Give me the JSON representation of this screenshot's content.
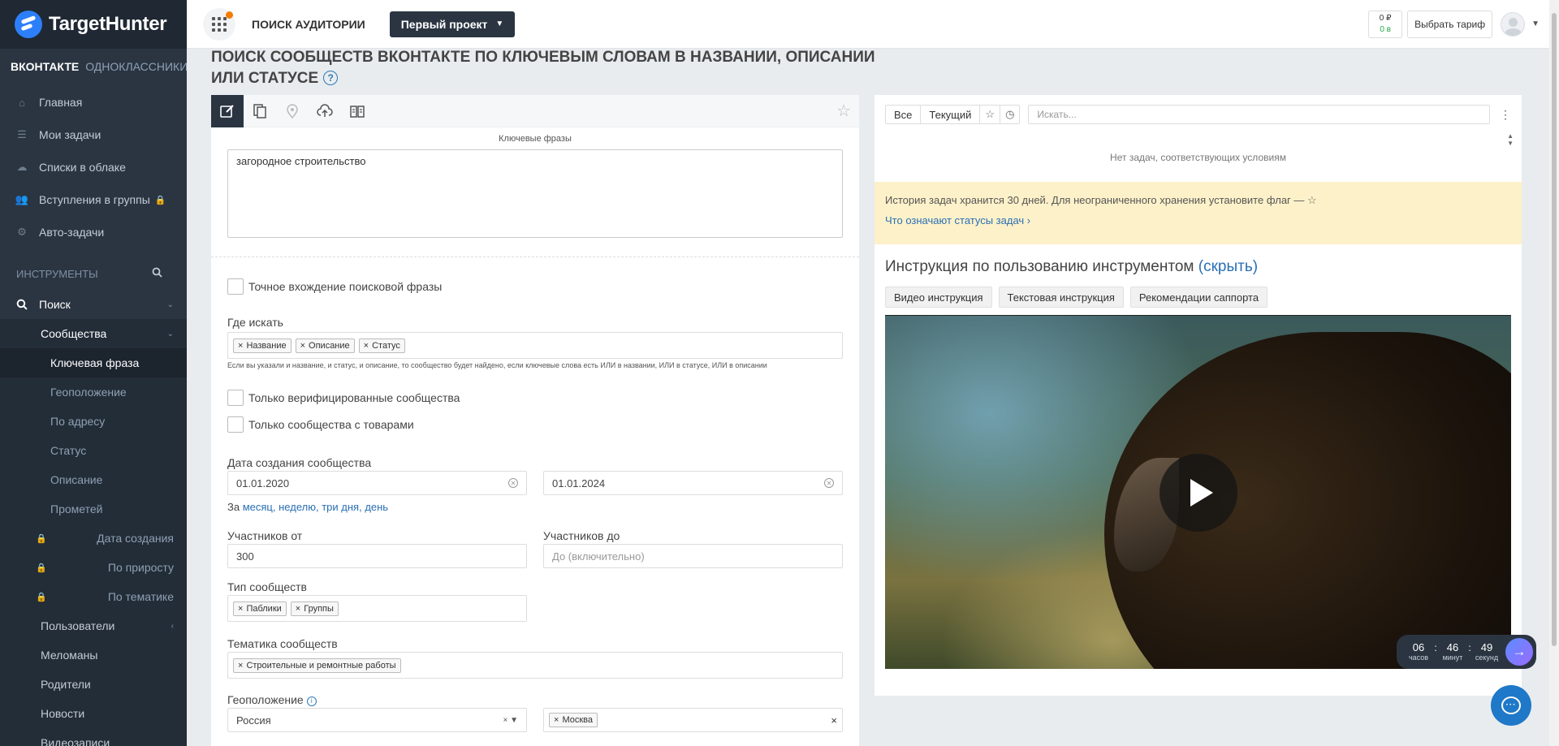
{
  "brand": {
    "name": "TargetHunter"
  },
  "networks": [
    "ВКОНТАКТЕ",
    "ОДНОКЛАССНИКИ"
  ],
  "nav": [
    {
      "label": "Главная",
      "icon": "home-icon"
    },
    {
      "label": "Мои задачи",
      "icon": "list-icon"
    },
    {
      "label": "Списки в облаке",
      "icon": "cloud-icon"
    },
    {
      "label": "Вступления в группы",
      "icon": "users-icon",
      "locked": true
    },
    {
      "label": "Авто-задачи",
      "icon": "gears-icon"
    }
  ],
  "tools": {
    "title": "ИНСТРУМЕНТЫ",
    "search": "Поиск",
    "communities": "Сообщества",
    "community_items": [
      {
        "label": "Ключевая фраза",
        "active": true
      },
      {
        "label": "Геоположение"
      },
      {
        "label": "По адресу"
      },
      {
        "label": "Статус"
      },
      {
        "label": "Описание"
      },
      {
        "label": "Прометей"
      },
      {
        "label": "Дата создания",
        "locked": true
      },
      {
        "label": "По приросту",
        "locked": true
      },
      {
        "label": "По тематике",
        "locked": true
      }
    ],
    "other_items": [
      "Пользователи",
      "Меломаны",
      "Родители",
      "Новости",
      "Видеозаписи"
    ]
  },
  "topbar": {
    "page_name": "ПОИСК АУДИТОРИИ",
    "project": "Первый проект",
    "balance_rub": "0 ₽",
    "balance_b": "0 в",
    "tariff": "Выбрать тариф"
  },
  "page": {
    "title": "ПОИСК СООБЩЕСТВ ВКОНТАКТЕ ПО КЛЮЧЕВЫМ СЛОВАМ В НАЗВАНИИ, ОПИСАНИИ ИЛИ СТАТУСЕ",
    "help": "?"
  },
  "form": {
    "keywords_label": "Ключевые фразы",
    "keywords_value": "загородное строительство",
    "exact_match": "Точное вхождение поисковой фразы",
    "where_label": "Где искать",
    "where_tags": [
      "Название",
      "Описание",
      "Статус"
    ],
    "where_hint": "Если вы указали и название, и статус, и описание, то сообщество будет найдено, если ключевые слова есть ИЛИ в названии, ИЛИ в статусе, ИЛИ в описании",
    "verified_only": "Только верифицированные сообщества",
    "goods_only": "Только сообщества с товарами",
    "date_label": "Дата создания сообщества",
    "date_from": "01.01.2020",
    "date_to": "01.01.2024",
    "period_prefix": "За",
    "period_links": [
      "месяц,",
      "неделю,",
      "три дня,",
      "день"
    ],
    "members_from_label": "Участников от",
    "members_from_value": "300",
    "members_to_label": "Участников до",
    "members_to_placeholder": "До (включительно)",
    "type_label": "Тип сообществ",
    "type_tags": [
      "Паблики",
      "Группы"
    ],
    "theme_label": "Тематика сообществ",
    "theme_tags": [
      "Строительные и ремонтные работы"
    ],
    "geo_label": "Геоположение",
    "geo_country": "Россия",
    "geo_city_tags": [
      "Москва"
    ]
  },
  "tasks": {
    "filter_all": "Все",
    "filter_current": "Текущий",
    "search_placeholder": "Искать...",
    "empty": "Нет задач, соответствующих условиям",
    "notice": "История задач хранится 30 дней. Для неограниченного хранения установите флаг —",
    "statuses_link": "Что означают статусы задач"
  },
  "instruction": {
    "title": "Инструкция по пользованию инструментом",
    "hide": "(скрыть)",
    "tabs": [
      "Видео инструкция",
      "Текстовая инструкция",
      "Рекомендации саппорта"
    ]
  },
  "timer": {
    "hours": "06",
    "hours_label": "часов",
    "minutes": "46",
    "minutes_label": "минут",
    "seconds": "49",
    "seconds_label": "секунд"
  },
  "colors": {
    "sidebar": "#2b3542",
    "accent": "#2a6fb5",
    "notice": "#fdf1c9"
  }
}
